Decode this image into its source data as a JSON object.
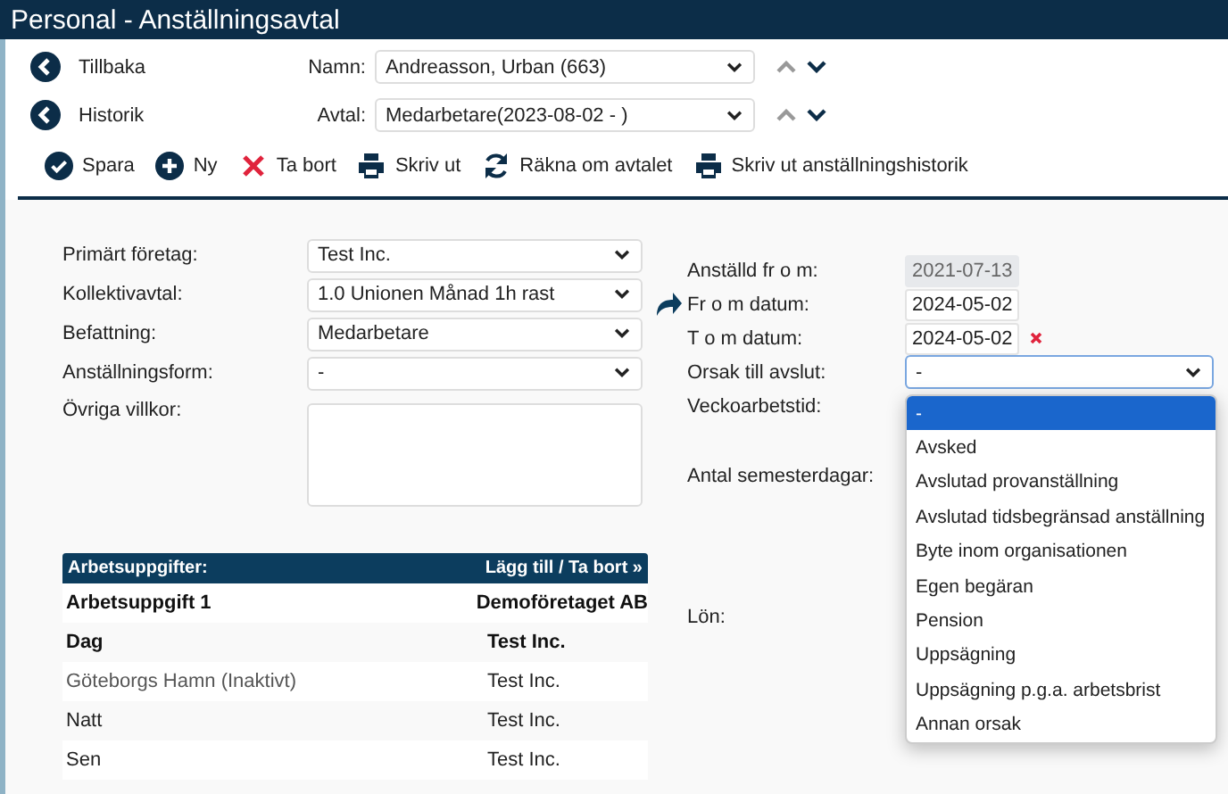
{
  "window": {
    "title": "Personal - Anställningsavtal"
  },
  "nav_links": [
    {
      "label": "Tillbaka"
    },
    {
      "label": "Historik"
    }
  ],
  "selectors": [
    {
      "label": "Namn:",
      "value": "Andreasson, Urban (663)",
      "prev_disabled": true,
      "next_disabled": false
    },
    {
      "label": "Avtal:",
      "value": "Medarbetare(2023-08-02 - )",
      "prev_disabled": true,
      "next_disabled": false
    }
  ],
  "toolbar": [
    {
      "kind": "check",
      "label": "Spara"
    },
    {
      "kind": "plus",
      "label": "Ny"
    },
    {
      "kind": "cross",
      "label": "Ta bort"
    },
    {
      "kind": "print",
      "label": "Skriv ut"
    },
    {
      "kind": "refresh",
      "label": "Räkna om avtalet"
    },
    {
      "kind": "print",
      "label": "Skriv ut anställningshistorik"
    }
  ],
  "left_fields": [
    {
      "kind": "select",
      "label": "Primärt företag:",
      "value": "Test Inc."
    },
    {
      "kind": "select",
      "label": "Kollektivavtal:",
      "value": "1.0 Unionen Månad 1h rast"
    },
    {
      "kind": "select",
      "label": "Befattning:",
      "value": "Medarbetare"
    },
    {
      "kind": "select",
      "label": "Anställningsform:",
      "value": "-"
    },
    {
      "kind": "textarea",
      "label": "Övriga villkor:"
    }
  ],
  "tasks": {
    "title": "Arbetsuppgifter:",
    "action": "Lägg till / Ta bort »",
    "rows": [
      {
        "kind": "group",
        "name": "Arbetsuppgift 1",
        "company": "Demoföretaget AB"
      },
      {
        "kind": "group",
        "name": "Dag",
        "company": "Test Inc."
      },
      {
        "kind": "inactive",
        "name": "Göteborgs Hamn (Inaktivt)",
        "company": "Test Inc."
      },
      {
        "kind": "item",
        "name": "Natt",
        "company": "Test Inc."
      },
      {
        "kind": "item",
        "name": "Sen",
        "company": "Test Inc."
      }
    ]
  },
  "right_fields": [
    {
      "kind": "readonly",
      "label": "Anställd fr o m:",
      "value": "2021-07-13"
    },
    {
      "kind": "date",
      "label": "Fr o m datum:",
      "value": "2024-05-02",
      "linked": true
    },
    {
      "kind": "date",
      "label": "T o m datum:",
      "value": "2024-05-02",
      "clearable": true
    },
    {
      "kind": "select",
      "label": "Orsak till avslut:",
      "value": "-",
      "expanded": true
    },
    {
      "kind": "label",
      "label": "Veckoarbetstid:"
    },
    {
      "kind": "label",
      "label": "Antal semesterdagar:"
    },
    {
      "kind": "label",
      "label": "Lön:"
    }
  ],
  "reason_options": [
    {
      "label": "-",
      "selected": true
    },
    {
      "label": "Avsked",
      "selected": false
    },
    {
      "label": "Avslutad provanställning",
      "selected": false
    },
    {
      "label": "Avslutad tidsbegränsad anställning",
      "selected": false
    },
    {
      "label": "Byte inom organisationen",
      "selected": false
    },
    {
      "label": "Egen begäran",
      "selected": false
    },
    {
      "label": "Pension",
      "selected": false
    },
    {
      "label": "Uppsägning",
      "selected": false
    },
    {
      "label": "Uppsägning p.g.a. arbetsbrist",
      "selected": false
    },
    {
      "label": "Annan orsak",
      "selected": false
    }
  ]
}
